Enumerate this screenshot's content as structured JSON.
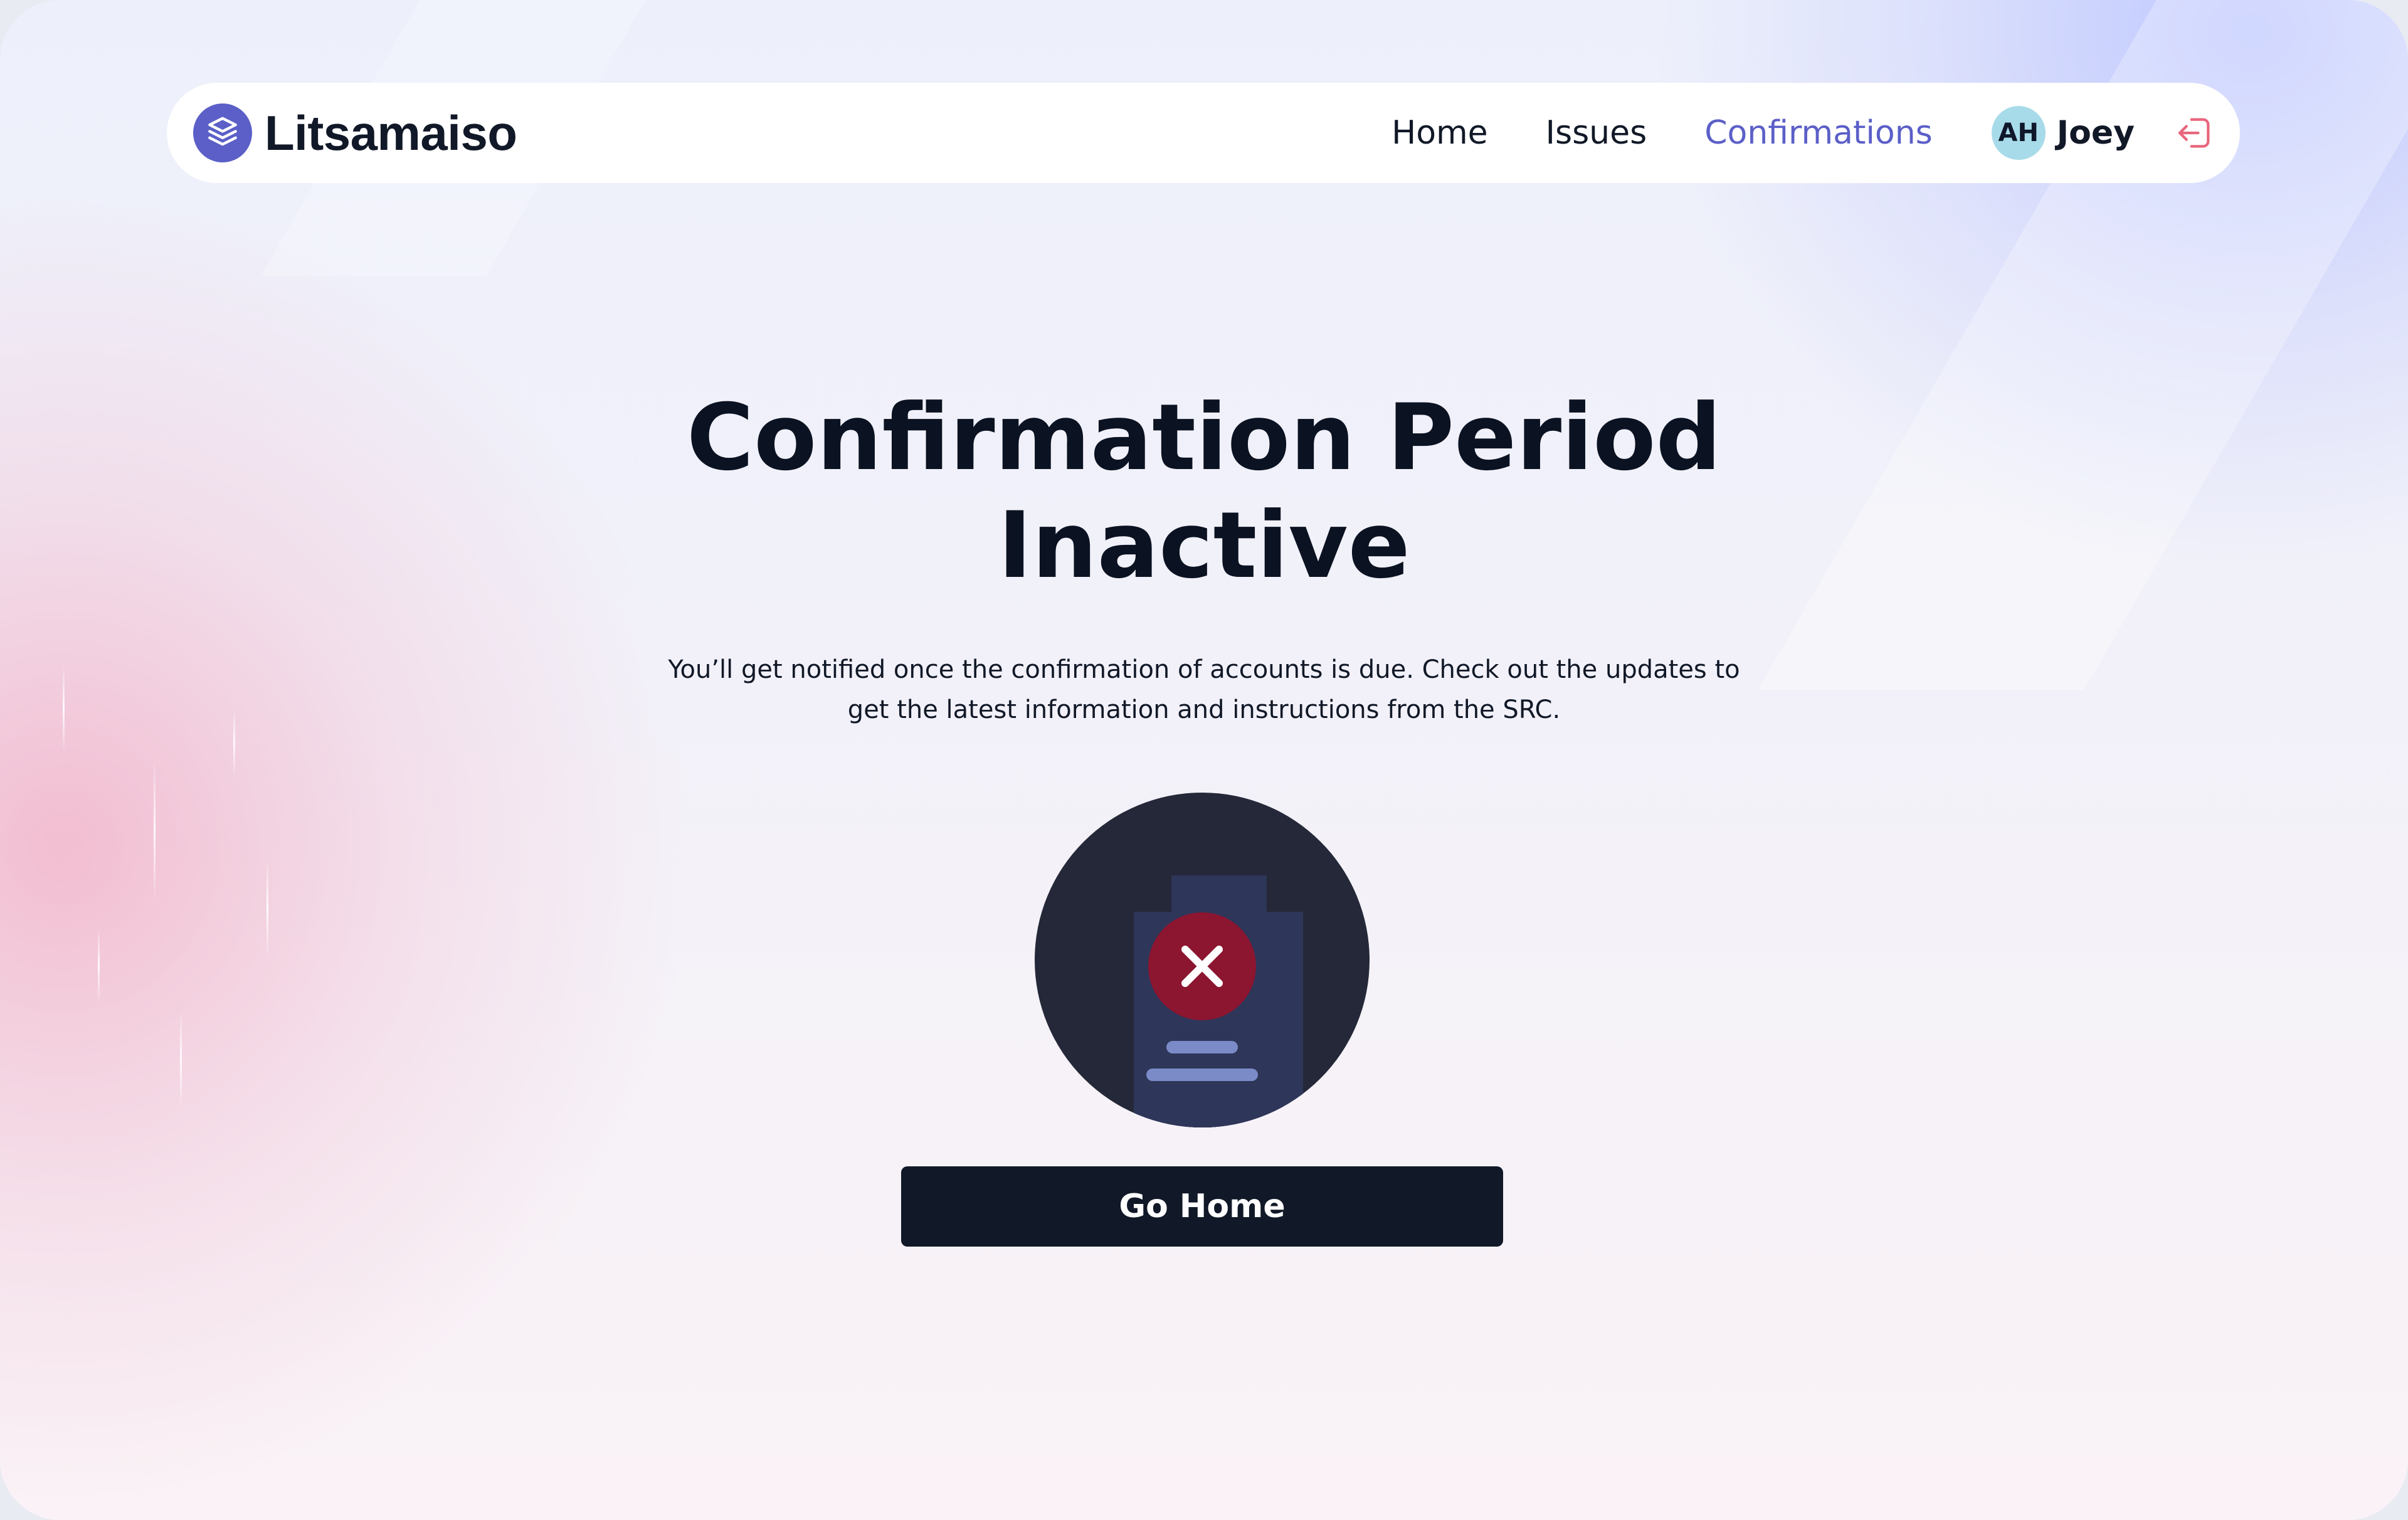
{
  "brand": {
    "name": "Litsamaiso",
    "logo_icon": "stack-layers-icon",
    "accent_color": "#5b5fc7"
  },
  "nav": {
    "links": [
      {
        "label": "Home",
        "active": false
      },
      {
        "label": "Issues",
        "active": false
      },
      {
        "label": "Confirmations",
        "active": true
      }
    ]
  },
  "user": {
    "initials": "AH",
    "name": "Joey",
    "logout_icon": "logout-icon",
    "logout_color": "#e8667c"
  },
  "main": {
    "title_line1": "Confirmation Period",
    "title_line2": "Inactive",
    "description_line1": "You’ll get notified once the confirmation of accounts is due. Check out the updates to",
    "description_line2": "get the latest information and instructions from the SRC.",
    "illustration_icon": "document-rejected-icon",
    "button_label": "Go Home"
  }
}
